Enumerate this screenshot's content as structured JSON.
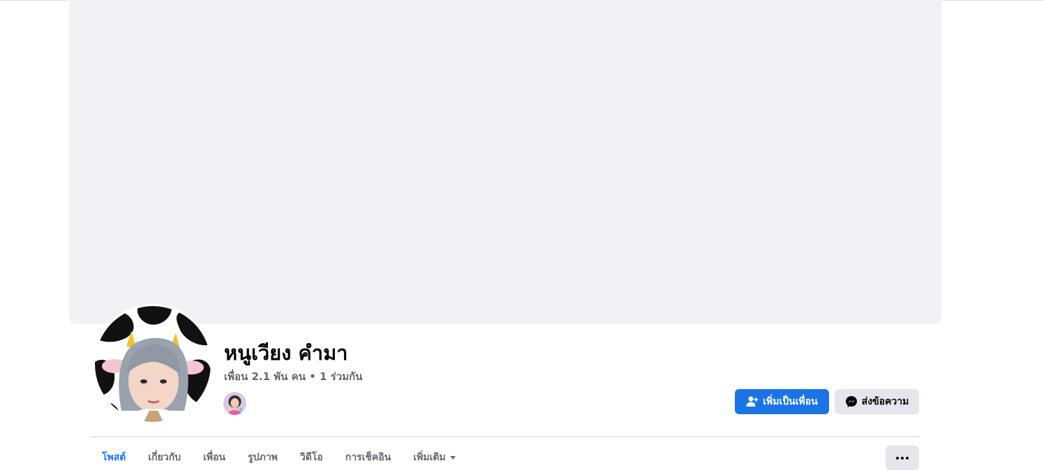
{
  "profile": {
    "name": "หนูเวียง คำมา",
    "friends_summary": "เพื่อน 2.1 พัน คน • 1 ร่วมกัน"
  },
  "actions": {
    "add_friend_label": "เพิ่มเป็นเพื่อน",
    "message_label": "ส่งข้อความ",
    "add_friend_icon": "person-add-icon",
    "message_icon": "messenger-icon",
    "more_icon": "more-dots-icon"
  },
  "tabs": [
    {
      "label": "โพสต์",
      "active": true
    },
    {
      "label": "เกี่ยวกับ",
      "active": false
    },
    {
      "label": "เพื่อน",
      "active": false
    },
    {
      "label": "รูปภาพ",
      "active": false
    },
    {
      "label": "วิดีโอ",
      "active": false
    },
    {
      "label": "การเช็คอิน",
      "active": false
    },
    {
      "label": "เพิ่มเติม",
      "active": false
    }
  ],
  "colors": {
    "accent": "#1b74e4",
    "cover_bg": "#f0f2f5",
    "secondary_button_bg": "#e4e6eb",
    "secondary_text": "#65676b"
  }
}
